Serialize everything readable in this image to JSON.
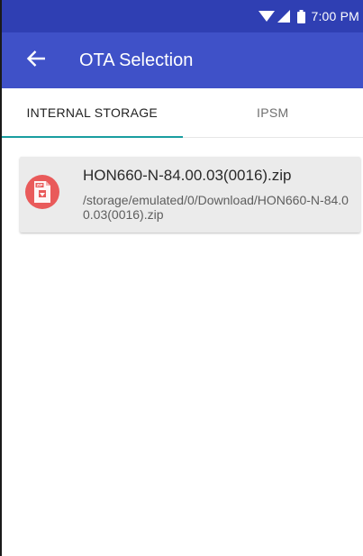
{
  "status_bar": {
    "time": "7:00 PM",
    "icons": [
      "wifi-icon",
      "cell-signal-icon",
      "battery-icon"
    ]
  },
  "app_bar": {
    "back_icon": "arrow-back-icon",
    "title": "OTA Selection",
    "color": "#3f51c8"
  },
  "tabs": [
    {
      "label": "INTERNAL STORAGE",
      "active": true
    },
    {
      "label": "IPSM",
      "active": false
    }
  ],
  "files": [
    {
      "name": "HON660-N-84.00.03(0016).zip",
      "path": "/storage/emulated/0/Download/HON660-N-84.00.03(0016).zip",
      "icon": "zip-file-icon",
      "icon_label": "ZIP"
    }
  ],
  "colors": {
    "status_bar": "#2f3fb3",
    "tab_indicator": "#1a9ea0",
    "file_icon_bg": "#e95a5a",
    "card_bg": "#ebebeb"
  }
}
